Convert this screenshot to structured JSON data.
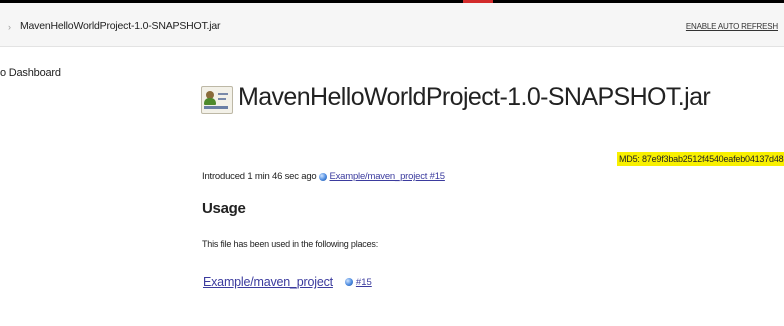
{
  "breadcrumb": {
    "separator": "›",
    "item": "MavenHelloWorldProject-1.0-SNAPSHOT.jar",
    "auto_refresh": "ENABLE AUTO REFRESH"
  },
  "sidebar": {
    "back_link": "o Dashboard"
  },
  "main": {
    "title": "MavenHelloWorldProject-1.0-SNAPSHOT.jar",
    "md5": "MD5: 87e9f3bab2512f4540eafeb04137d48",
    "introduced_text": "Introduced 1 min 46 sec ago",
    "introduced_link": "Example/maven_project #15",
    "usage_heading": "Usage",
    "usage_description": "This file has been used in the following places:",
    "usages": [
      {
        "job": "Example/maven_project",
        "build": "#15"
      }
    ]
  },
  "colors": {
    "md5_highlight": "#f8f000",
    "link": "#3b3b9e",
    "header_bg": "#f6f6f6",
    "top_accent": "#d22b2b"
  },
  "icons": {
    "artifact": "jar-badge-icon",
    "status": "blue-ball-icon"
  }
}
